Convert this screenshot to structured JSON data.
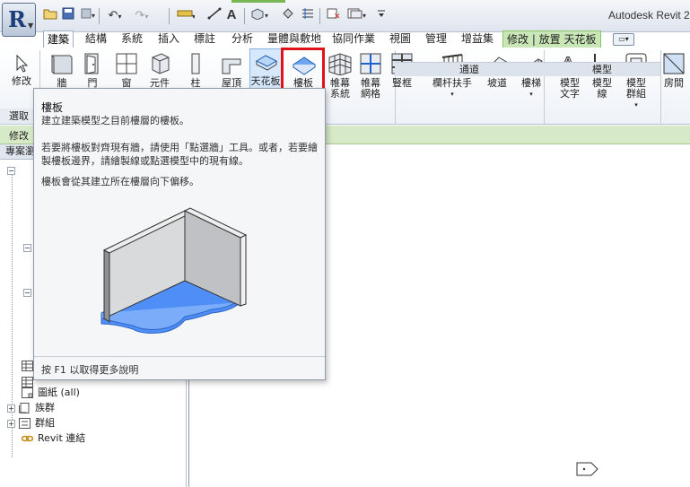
{
  "window": {
    "title": "Autodesk Revit 2"
  },
  "qat": {
    "icons": [
      "folder-open-icon",
      "save-icon",
      "sync-icon",
      "undo-icon",
      "redo-icon",
      "measure-icon",
      "dimension-icon",
      "text-icon",
      "3d-view-icon",
      "section-icon",
      "thin-lines-icon",
      "close-hidden-icon",
      "switch-windows-icon",
      "customize-icon"
    ]
  },
  "tabs": [
    {
      "label": "建築",
      "state": "active"
    },
    {
      "label": "結構"
    },
    {
      "label": "系統"
    },
    {
      "label": "插入"
    },
    {
      "label": "標註"
    },
    {
      "label": "分析"
    },
    {
      "label": "量體與敷地"
    },
    {
      "label": "協同作業"
    },
    {
      "label": "視圖"
    },
    {
      "label": "管理"
    },
    {
      "label": "增益集"
    },
    {
      "label": "修改 | 放置 天花板",
      "state": "context"
    }
  ],
  "ribbon": {
    "buttons": [
      {
        "label": "修改",
        "icon": "cursor-icon"
      },
      {
        "label": "牆",
        "icon": "wall-icon"
      },
      {
        "label": "門",
        "icon": "door-icon"
      },
      {
        "label": "窗",
        "icon": "window-icon"
      },
      {
        "label": "元件",
        "icon": "component-icon"
      },
      {
        "label": "柱",
        "icon": "column-icon"
      },
      {
        "label": "屋頂",
        "icon": "roof-icon"
      },
      {
        "label": "天花板",
        "icon": "ceiling-icon"
      },
      {
        "label": "樓板",
        "icon": "floor-icon"
      },
      {
        "label": "帷幕\n系統",
        "icon": "curtain-system-icon"
      },
      {
        "label": "帷幕\n網格",
        "icon": "curtain-grid-icon"
      },
      {
        "label": "豎框",
        "icon": "mullion-icon"
      },
      {
        "label": "欄杆扶手",
        "icon": "railing-icon"
      },
      {
        "label": "坡道",
        "icon": "ramp-icon"
      },
      {
        "label": "樓梯",
        "icon": "stair-icon"
      },
      {
        "label": "模型\n文字",
        "icon": "model-text-icon"
      },
      {
        "label": "模型\n線",
        "icon": "model-line-icon"
      },
      {
        "label": "模型\n群組",
        "icon": "model-group-icon"
      },
      {
        "label": "房間",
        "icon": "room-icon"
      }
    ],
    "panels": [
      "通道",
      "模型"
    ]
  },
  "left_rows": {
    "select": "選取",
    "options": "修改",
    "browser_header": "專案瀏"
  },
  "tree": [
    {
      "label": "圖紙 (all)",
      "icon": "sheet-icon"
    },
    {
      "label": "族群",
      "icon": "family-icon"
    },
    {
      "label": "群組",
      "icon": "group-icon"
    },
    {
      "label": "Revit 連結",
      "icon": "link-icon"
    }
  ],
  "tooltip": {
    "title": "樓板",
    "description": "建立建築模型之目前樓層的樓板。",
    "paragraph1": "若要將樓板對齊現有牆，請使用「點選牆」工具。或者，若要繪\n製樓板邊界，請繪製線或點選模型中的現有線。",
    "paragraph2": "樓板會從其建立所在樓層向下偏移。",
    "footer": "按 F1 以取得更多說明"
  },
  "colors": {
    "accent_red": "#e0121a",
    "context_green": "#c9e7b6",
    "floor_blue": "#4f8ef7"
  }
}
